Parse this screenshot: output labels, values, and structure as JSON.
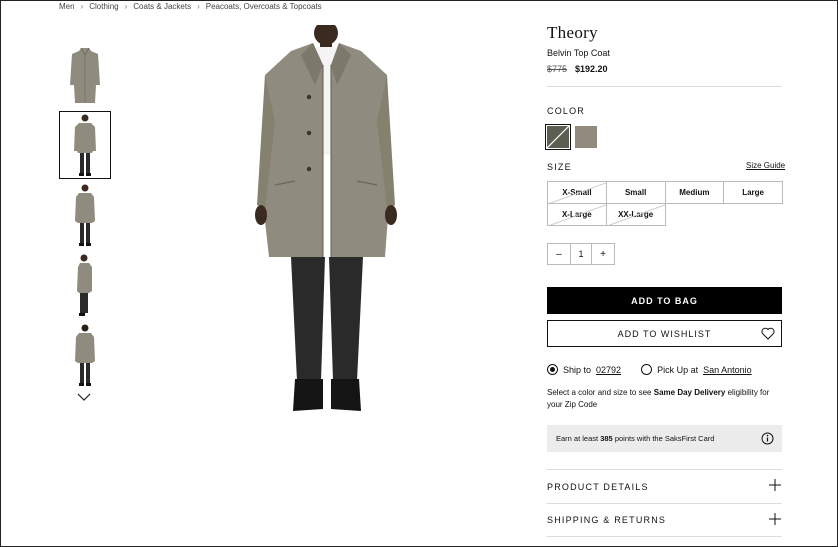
{
  "breadcrumb": [
    "Men",
    "Clothing",
    "Coats & Jackets",
    "Peacoats, Overcoats & Topcoats"
  ],
  "product": {
    "brand": "Theory",
    "name": "Belvin Top Coat",
    "price_original": "$775",
    "price_sale": "$192.20"
  },
  "color": {
    "label": "COLOR",
    "swatches": [
      {
        "name": "olive-herringbone",
        "hex": "#5d5e52",
        "selected": true
      },
      {
        "name": "taupe",
        "hex": "#918a7d",
        "selected": false
      }
    ]
  },
  "size": {
    "label": "SIZE",
    "guide_label": "Size Guide",
    "options": [
      {
        "label": "X-Small",
        "available": false
      },
      {
        "label": "Small",
        "available": true
      },
      {
        "label": "Medium",
        "available": true
      },
      {
        "label": "Large",
        "available": true
      },
      {
        "label": "X-Large",
        "available": false
      },
      {
        "label": "XX-Large",
        "available": false
      }
    ]
  },
  "quantity": {
    "minus": "–",
    "value": "1",
    "plus": "+"
  },
  "actions": {
    "add_to_bag": "ADD TO BAG",
    "add_to_wishlist": "ADD TO WISHLIST"
  },
  "shipping": {
    "ship_to_label": "Ship to",
    "zip": "02792",
    "pickup_label": "Pick Up at",
    "store": "San Antonio"
  },
  "delivery_note": {
    "prefix": "Select a color and size to see",
    "bold": "Same Day Delivery",
    "suffix": "eligibility for your Zip Code"
  },
  "points": {
    "prefix": "Earn at least",
    "count": "385",
    "suffix": "points with the SaksFirst Card"
  },
  "accordions": {
    "product_details": "PRODUCT DETAILS",
    "shipping_returns": "SHIPPING & RETURNS"
  },
  "colors": {
    "accent": "#000000",
    "coat": "#8f8b7e",
    "pants": "#2a2a2a"
  }
}
